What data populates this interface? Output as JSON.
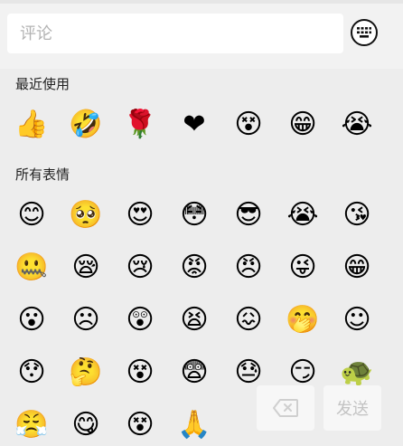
{
  "composer": {
    "placeholder": "评论",
    "keyboard_icon": "keyboard-icon"
  },
  "recent": {
    "title": "最近使用",
    "items": [
      {
        "name": "thumbs-up",
        "glyph": "👍"
      },
      {
        "name": "rolling-laugh",
        "glyph": "🤣"
      },
      {
        "name": "rose",
        "glyph": "🌹"
      },
      {
        "name": "heart",
        "glyph": "❤"
      },
      {
        "name": "confused",
        "glyph": "😵"
      },
      {
        "name": "grin",
        "glyph": "😁"
      },
      {
        "name": "crying",
        "glyph": "😭"
      }
    ]
  },
  "all": {
    "title": "所有表情",
    "items": [
      {
        "name": "smile",
        "glyph": "😊"
      },
      {
        "name": "pouting",
        "glyph": "🥺"
      },
      {
        "name": "heart-eyes",
        "glyph": "😍"
      },
      {
        "name": "dazed",
        "glyph": "😳"
      },
      {
        "name": "sunglasses",
        "glyph": "😎"
      },
      {
        "name": "tearful",
        "glyph": "😭"
      },
      {
        "name": "blushing",
        "glyph": "😘"
      },
      {
        "name": "mouth-sealed",
        "glyph": "🤐"
      },
      {
        "name": "sleepy",
        "glyph": "😪"
      },
      {
        "name": "sad-crying",
        "glyph": "😢"
      },
      {
        "name": "angry-red",
        "glyph": "😡"
      },
      {
        "name": "furious",
        "glyph": "😠"
      },
      {
        "name": "wink-tongue",
        "glyph": "😜"
      },
      {
        "name": "big-grin",
        "glyph": "😁"
      },
      {
        "name": "surprised",
        "glyph": "😮"
      },
      {
        "name": "frown",
        "glyph": "☹"
      },
      {
        "name": "shocked",
        "glyph": "😲"
      },
      {
        "name": "scream",
        "glyph": "😫"
      },
      {
        "name": "puzzled",
        "glyph": "😖"
      },
      {
        "name": "hush",
        "glyph": "🤭"
      },
      {
        "name": "content",
        "glyph": "☺"
      },
      {
        "name": "astonished",
        "glyph": "😯"
      },
      {
        "name": "thinking",
        "glyph": "🤔"
      },
      {
        "name": "dizzy",
        "glyph": "😵"
      },
      {
        "name": "fearful",
        "glyph": "😨"
      },
      {
        "name": "sweat",
        "glyph": "😓"
      },
      {
        "name": "smug",
        "glyph": "😏"
      },
      {
        "name": "turtle",
        "glyph": "🐢"
      },
      {
        "name": "headband",
        "glyph": "😤"
      },
      {
        "name": "yummy",
        "glyph": "😋"
      },
      {
        "name": "confused-2",
        "glyph": "😵"
      },
      {
        "name": "pray",
        "glyph": "🙏"
      }
    ]
  },
  "actions": {
    "delete_icon": "backspace-icon",
    "send_label": "发送"
  },
  "colors": {
    "background": "#ededed",
    "topbar": "#f2f2f2",
    "placeholder": "#b3b3b3",
    "disabled_text": "#c3c3c3"
  }
}
